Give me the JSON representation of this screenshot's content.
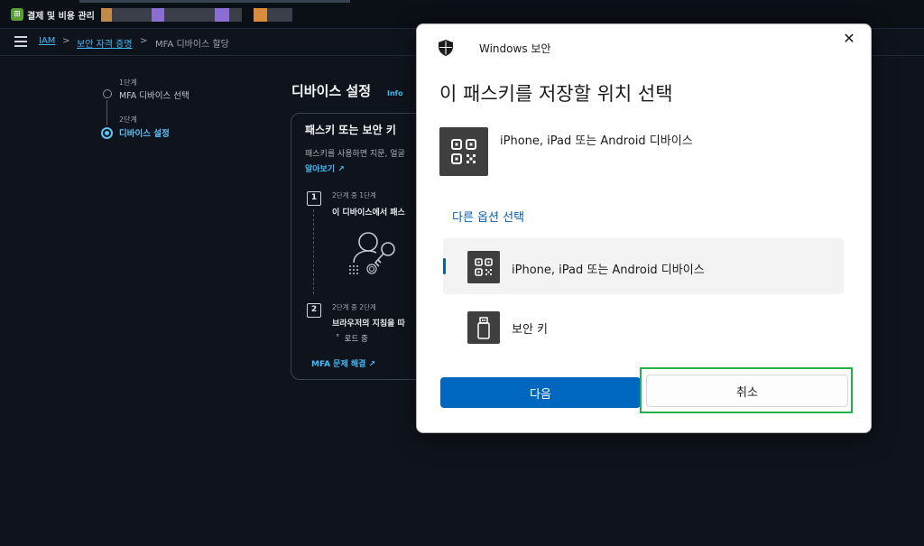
{
  "topbar": {
    "app_name": "결제 및 비용 관리",
    "logo_glyph": "⊞",
    "redacted_colors": [
      "#c08a4b",
      "#3a3f4a",
      "#8b6ed1",
      "#3a3f4a",
      "#8b6ed1",
      "#3a3f4a",
      "#d98c3d",
      "#3a3f4a"
    ]
  },
  "breadcrumb": {
    "items": [
      {
        "label": "IAM",
        "link": true
      },
      {
        "label": "보안 자격 증명",
        "link": true
      },
      {
        "label": "MFA 디바이스 할당",
        "link": false
      }
    ],
    "separator": ">"
  },
  "steps": [
    {
      "label": "1단계",
      "name": "MFA 디바이스 선택",
      "active": false
    },
    {
      "label": "2단계",
      "name": "디바이스 설정",
      "active": true
    }
  ],
  "section": {
    "title": "디바이스 설정",
    "info": "Info"
  },
  "card": {
    "title": "패스키 또는 보안 키",
    "desc": "패스키를 사용하면 지문, 얼굴",
    "learn_more": "알아보기",
    "substeps": [
      {
        "num": "1",
        "meta": "2단계 중 1단계",
        "title": "이 디바이스에서 패스"
      },
      {
        "num": "2",
        "meta": "2단계 중 2단계",
        "title": "브라우저의 지침을 따"
      }
    ],
    "loading": "로드 중",
    "mfa_link": "MFA 문제 해결"
  },
  "dialog": {
    "app_title": "Windows 보안",
    "heading": "이 패스키를 저장할 위치 선택",
    "primary_option": "iPhone, iPad 또는 Android 디바이스",
    "other_options_label": "다른 옵션 선택",
    "options": [
      {
        "label": "iPhone, iPad 또는 Android 디바이스",
        "icon": "qr-code-icon",
        "selected": true
      },
      {
        "label": "보안 키",
        "icon": "usb-key-icon",
        "selected": false
      }
    ],
    "next_label": "다음",
    "cancel_label": "취소",
    "close_glyph": "✕"
  },
  "colors": {
    "accent_blue": "#0067c0",
    "link_blue": "#44b9f5",
    "highlight_green": "#22b14c"
  }
}
